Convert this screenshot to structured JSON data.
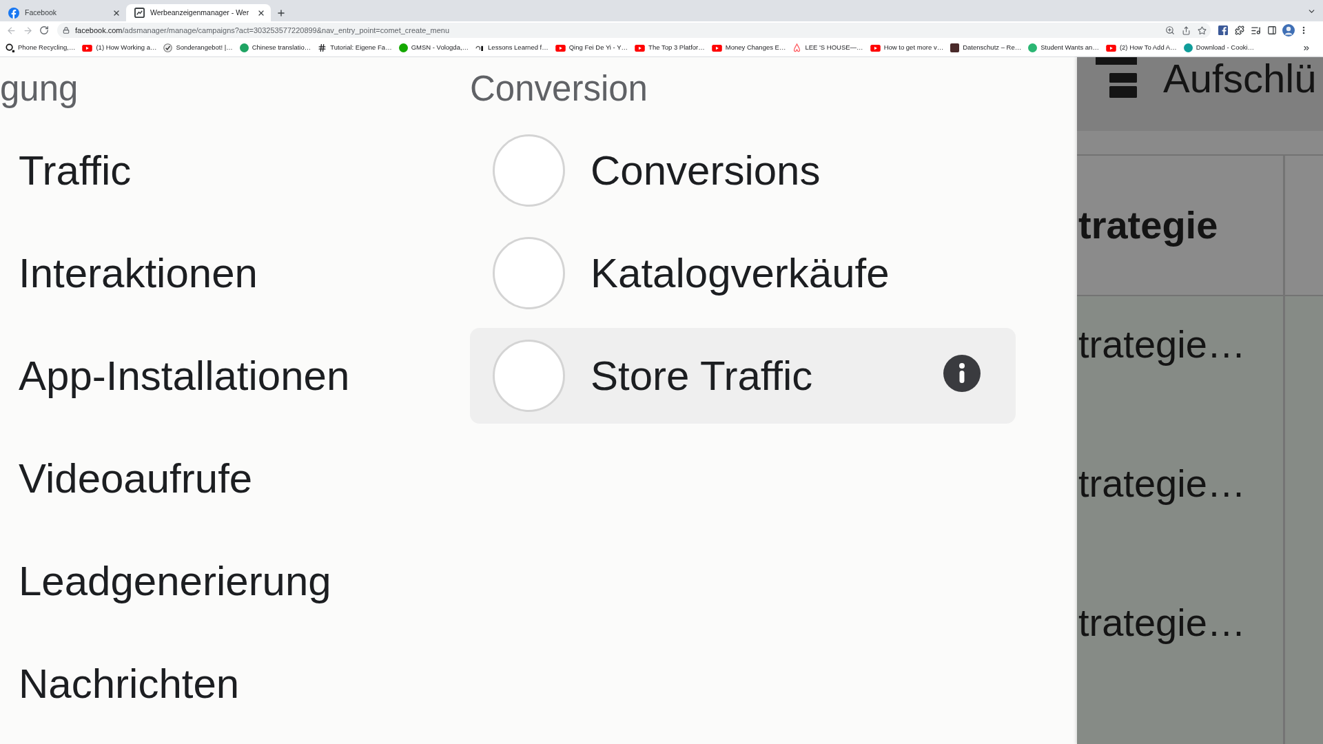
{
  "browser": {
    "tabs": [
      {
        "title": "Facebook",
        "selected": false,
        "kind": "facebook"
      },
      {
        "title": "Werbeanzeigenmanager - Wer",
        "selected": true,
        "kind": "ads"
      }
    ],
    "url": {
      "host": "facebook.com",
      "path": "/adsmanager/manage/campaigns?act=303253577220899&nav_entry_point=comet_create_menu"
    },
    "bookmarks": [
      {
        "label": "Phone Recycling,…",
        "kind": "o2"
      },
      {
        "label": "(1) How Working a…",
        "kind": "video"
      },
      {
        "label": "Sonderangebot! |…",
        "kind": "seal"
      },
      {
        "label": "Chinese translatio…",
        "kind": "dot",
        "color": "#1fa463"
      },
      {
        "label": "Tutorial: Eigene Fa…",
        "kind": "hash"
      },
      {
        "label": "GMSN - Vologda,…",
        "kind": "dot",
        "color": "#14a800"
      },
      {
        "label": "Lessons Learned f…",
        "kind": "mark"
      },
      {
        "label": "Qing Fei De Yi - Y…",
        "kind": "video"
      },
      {
        "label": "The Top 3 Platfor…",
        "kind": "video"
      },
      {
        "label": "Money Changes E…",
        "kind": "video"
      },
      {
        "label": "LEE 'S HOUSE—…",
        "kind": "airbnb"
      },
      {
        "label": "How to get more v…",
        "kind": "video"
      },
      {
        "label": "Datenschutz – Re…",
        "kind": "photo"
      },
      {
        "label": "Student Wants an…",
        "kind": "dot",
        "color": "#2bb673"
      },
      {
        "label": "(2) How To Add A…",
        "kind": "video"
      },
      {
        "label": "Download - Cooki…",
        "kind": "dot",
        "color": "#0f9d9a"
      }
    ]
  },
  "objectives": {
    "heading": "gung",
    "items": [
      "Traffic",
      "Interaktionen",
      "App-Installationen",
      "Videoaufrufe",
      "Leadgenerierung",
      "Nachrichten"
    ]
  },
  "conversion": {
    "heading": "Conversion",
    "options": [
      {
        "label": "Conversions",
        "selected": false,
        "hovered": false
      },
      {
        "label": "Katalogverkäufe",
        "selected": false,
        "hovered": false
      },
      {
        "label": "Store Traffic",
        "selected": false,
        "hovered": true
      }
    ]
  },
  "background_panel": {
    "title": "Aufschlü",
    "table": {
      "header": "trategie",
      "rows": [
        "trategie…",
        "trategie…",
        "trategie…"
      ]
    }
  }
}
